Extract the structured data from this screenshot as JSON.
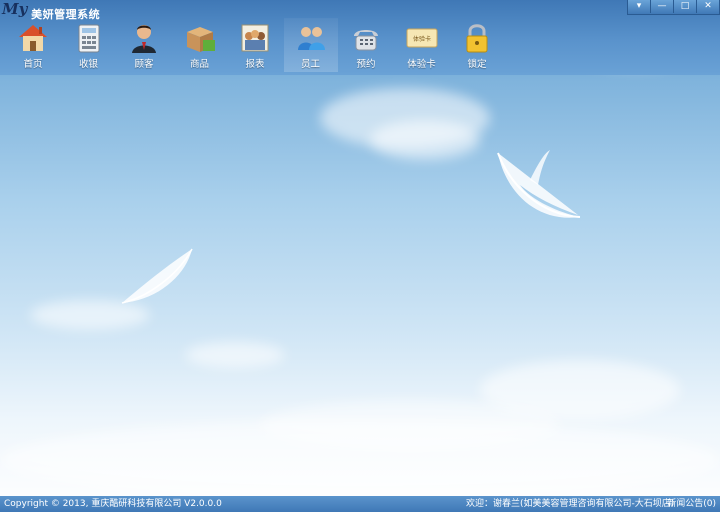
{
  "app": {
    "brand_my": "My",
    "brand_name": "美妍管理系统"
  },
  "window_controls": [
    "▾",
    "—",
    "□",
    "✕"
  ],
  "toolbar": [
    {
      "label": "首页",
      "icon": "home-icon"
    },
    {
      "label": "收银",
      "icon": "cash-register-icon"
    },
    {
      "label": "顾客",
      "icon": "customer-icon"
    },
    {
      "label": "商品",
      "icon": "goods-box-icon"
    },
    {
      "label": "报表",
      "icon": "report-icon"
    },
    {
      "label": "员工",
      "icon": "staff-icon",
      "active": true
    },
    {
      "label": "预约",
      "icon": "phone-icon"
    },
    {
      "label": "体验卡",
      "icon": "experience-card-icon",
      "card_text": "体验卡"
    },
    {
      "label": "锁定",
      "icon": "lock-icon"
    }
  ],
  "status": {
    "copyright": "Copyright © 2013, 重庆酷研科技有限公司 V2.0.0.0",
    "welcome": "欢迎：谢春兰(如美美容管理咨询有限公司-大石坝店)",
    "notice": "新闻公告(0)"
  }
}
